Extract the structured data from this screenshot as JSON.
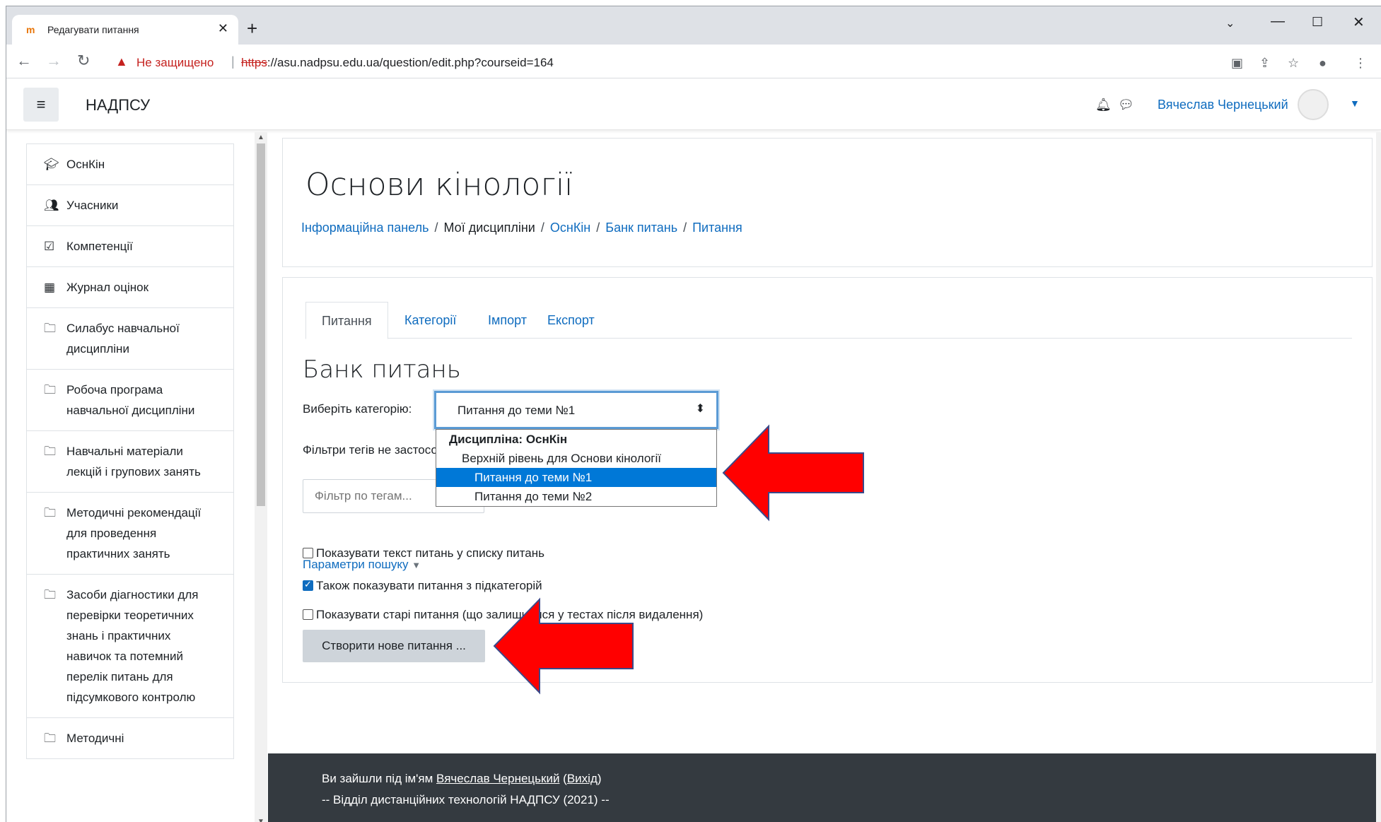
{
  "browser": {
    "tab_title": "Редагувати питання",
    "favicon_text": "m",
    "address": {
      "security_label": "Не защищено",
      "scheme": "https",
      "url_rest": "://asu.nadpsu.edu.ua/question/edit.php?courseid=164"
    }
  },
  "navbar": {
    "brand": "НАДПСУ",
    "user_name": "Вячеслав Чернецький"
  },
  "sidebar": {
    "items": [
      {
        "label": "ОснКін",
        "icon": "graduation-cap-icon"
      },
      {
        "label": "Учасники",
        "icon": "users-icon"
      },
      {
        "label": "Компетенції",
        "icon": "checkbox-icon"
      },
      {
        "label": "Журнал оцінок",
        "icon": "table-icon"
      },
      {
        "label": "Силабус навчальної дисципліни",
        "icon": "folder-icon"
      },
      {
        "label": "Робоча програма навчальної дисципліни",
        "icon": "folder-icon"
      },
      {
        "label": "Навчальні матеріали лекцій і групових занять",
        "icon": "folder-icon"
      },
      {
        "label": "Методичні рекомендації для проведення практичних занять",
        "icon": "folder-icon"
      },
      {
        "label": "Засоби діагностики для перевірки теоретичних знань і практичних навичок та потемний перелік питань для підсумкового контролю",
        "icon": "folder-icon"
      },
      {
        "label": "Методичні",
        "icon": "folder-icon"
      }
    ]
  },
  "header": {
    "course_title": "Основи кінології",
    "breadcrumb": {
      "dashboard": "Інформаційна панель",
      "my_courses": "Мої дисципліни",
      "course": "ОснКін",
      "bank": "Банк питань",
      "questions": "Питання"
    }
  },
  "main": {
    "tabs": [
      "Питання",
      "Категорії",
      "Імпорт",
      "Експорт"
    ],
    "bank_heading": "Банк питань",
    "category_label": "Виберіть категорію:",
    "category_selected": "Питання до теми №1",
    "dropdown": {
      "group": "Дисципліна: ОснКін",
      "options": [
        "Верхній рівень для Основи кінології",
        "Питання до теми №1",
        "Питання до теми №2"
      ]
    },
    "filter_label": "Фільтри тегів не застосовано",
    "tag_filter_placeholder": "Фільтр по тегам...",
    "show_text_label": "Показувати текст питань у списку питань",
    "search_params": "Параметри пошуку",
    "subcats_label": "Також показувати питання з підкатегорій",
    "old_label": "Показувати старі питання (що залишилися у тестах після видалення)",
    "create_button": "Створити нове питання ..."
  },
  "footer": {
    "logged_in_prefix": "Ви зайшли під ім'ям",
    "user_link": "Вячеслав Чернецький",
    "logout": "Вихід",
    "org_line": "-- Відділ дистанційних технологій НАДПСУ (2021) --"
  },
  "colors": {
    "link": "#0f6cbf",
    "arrow": "#ff0000",
    "footer_bg": "#343a40"
  }
}
